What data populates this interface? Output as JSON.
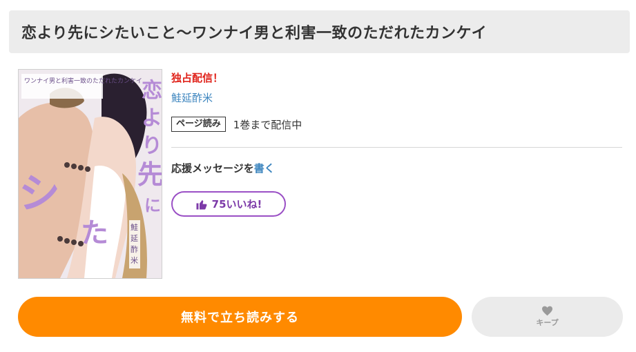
{
  "title": "恋より先にシたいこと～ワンナイ男と利害一致のただれたカンケイ",
  "cover": {
    "alt": "恋より先にシたいこと～ワンナイ男と利害一致のただれたカンケイ 表紙",
    "subtitle_text": "ワンナイ男と利害一致のただれたカンケイ",
    "vertical_title": "恋より先にシたいこと",
    "author_vertical": "鮭延酢米",
    "accent_color": "#b58bd6"
  },
  "info": {
    "exclusive_label": "独占配信！",
    "author": "鮭延酢米",
    "read_tag": "ページ読み",
    "read_note": "1巻まで配信中",
    "support_text": "応援メッセージを",
    "support_link": "書く",
    "like_label": "75いいね!"
  },
  "actions": {
    "read_label": "無料で立ち読みする",
    "keep_label": "キープ"
  },
  "colors": {
    "exclusive": "#e0231b",
    "link": "#3e86bf",
    "like_border": "#9a4fc5",
    "read_button": "#ff8a00",
    "keep_button": "#ebebeb"
  }
}
